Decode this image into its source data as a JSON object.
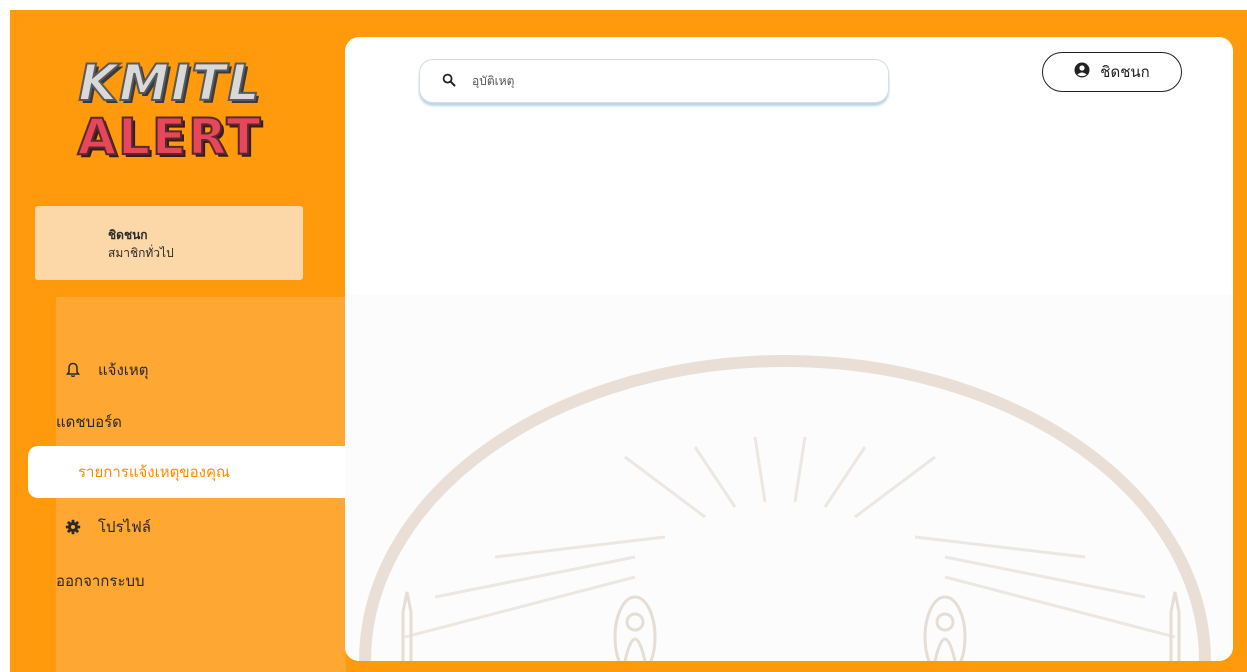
{
  "logo": {
    "line1": "KMITL",
    "line2": "ALERT"
  },
  "user": {
    "name": "ชิดชนก",
    "role": "สมาชิกทั่วไป"
  },
  "nav": {
    "report": "แจ้งเหตุ",
    "dashboard": "แดชบอร์ด",
    "my_reports": "รายการแจ้งเหตุของคุณ",
    "profile": "โปรไฟล์",
    "logout": "ออกจากระบบ"
  },
  "search": {
    "placeholder": "อุบัติเหตุ"
  },
  "header": {
    "user_button": "ชิดชนก"
  },
  "colors": {
    "accent": "#ff9a0c",
    "active_text": "#ff8a00",
    "card": "#fcd7a7"
  },
  "icons": {
    "report": "bell-icon",
    "profile": "gear-icon",
    "search": "search-icon",
    "user": "user-circle-icon"
  }
}
